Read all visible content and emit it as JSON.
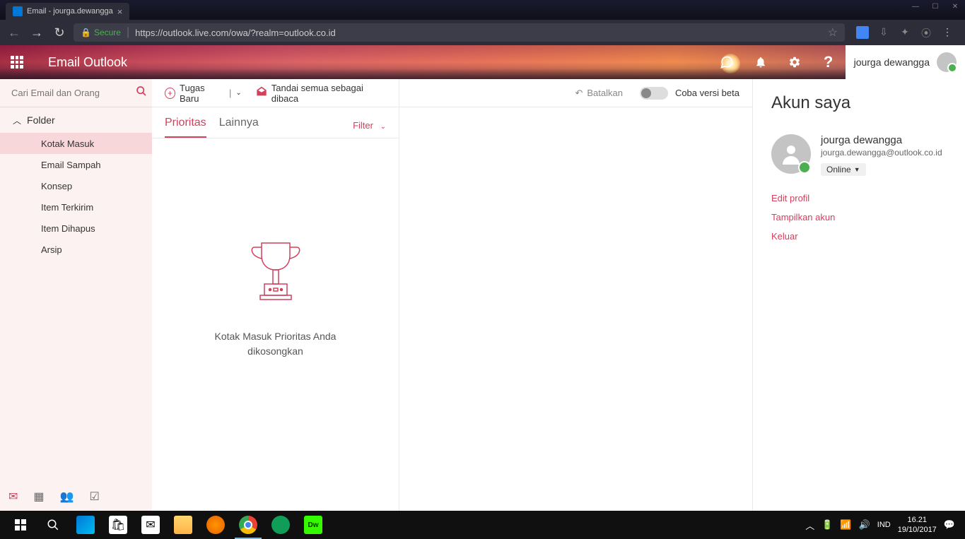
{
  "browser": {
    "tab_title": "Email - jourga.dewangga",
    "secure_label": "Secure",
    "url": "https://outlook.live.com/owa/?realm=outlook.co.id"
  },
  "header": {
    "app_title": "Email Outlook",
    "user_name": "jourga dewangga"
  },
  "sidebar": {
    "search_placeholder": "Cari Email dan Orang",
    "folder_header": "Folder",
    "folders": [
      "Kotak Masuk",
      "Email Sampah",
      "Konsep",
      "Item Terkirim",
      "Item Dihapus",
      "Arsip"
    ]
  },
  "commandbar": {
    "new_task": "Tugas Baru",
    "mark_all_read": "Tandai semua sebagai dibaca",
    "undo": "Batalkan",
    "try_beta": "Coba versi beta"
  },
  "tabs": {
    "priority": "Prioritas",
    "other": "Lainnya",
    "filter": "Filter"
  },
  "empty_state": {
    "line1": "Kotak Masuk Prioritas Anda",
    "line2": "dikosongkan"
  },
  "account_panel": {
    "title": "Akun saya",
    "name": "jourga dewangga",
    "email": "jourga.dewangga@outlook.co.id",
    "status": "Online",
    "links": [
      "Edit profil",
      "Tampilkan akun",
      "Keluar"
    ]
  },
  "taskbar": {
    "lang": "IND",
    "time": "16.21",
    "date": "19/10/2017"
  }
}
